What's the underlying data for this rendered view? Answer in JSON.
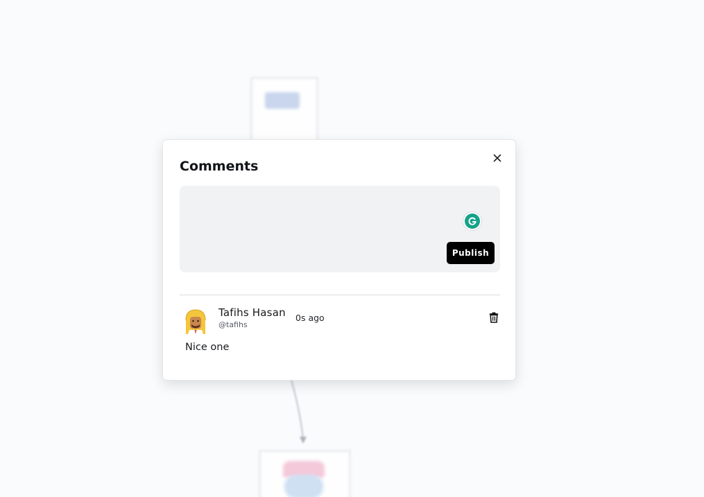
{
  "modal": {
    "title": "Comments",
    "close_icon": "close-icon"
  },
  "composer": {
    "value": "",
    "placeholder": "",
    "grammarly_icon": "grammarly-icon",
    "publish_label": "Publish"
  },
  "comments": [
    {
      "author_name": "Tafihs Hasan",
      "author_handle": "@tafihs",
      "time": "0s ago",
      "text": "Nice one",
      "avatar_icon": "avatar-icon",
      "delete_icon": "trash-icon"
    }
  ],
  "colors": {
    "publish_bg": "#000000",
    "editor_bg": "#f1f2f4",
    "grammarly": "#15a38a"
  }
}
